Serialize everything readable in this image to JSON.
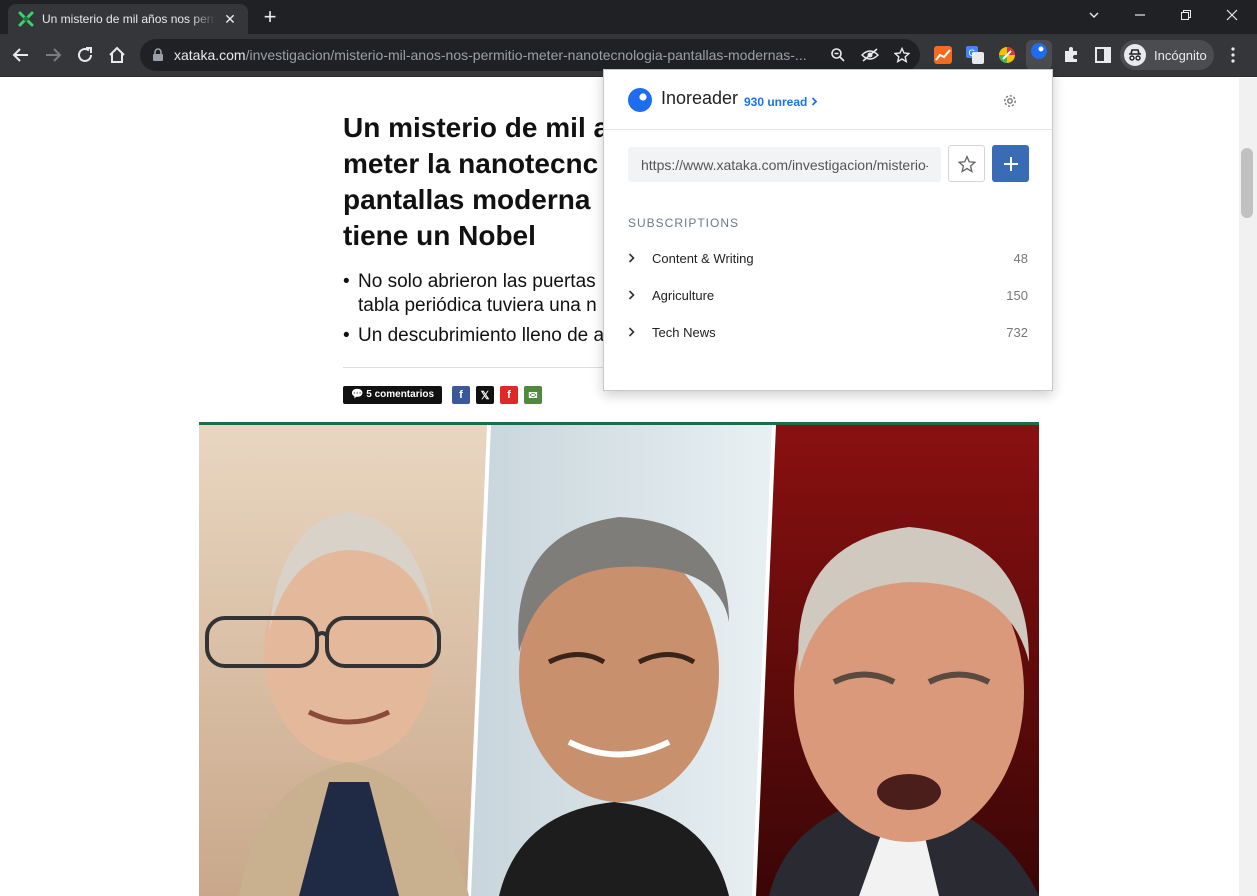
{
  "tab": {
    "title": "Un misterio de mil años nos permitió meter la nanotecnología en las pantallas modernas",
    "close": "✕"
  },
  "new_tab_symbol": "+",
  "omnibox": {
    "host": "xataka.com",
    "path": "/investigacion/misterio-mil-anos-nos-permitio-meter-nanotecnologia-pantallas-modernas-..."
  },
  "extensions": {
    "inoreader_badge": "930"
  },
  "profile": {
    "label": "Incógnito"
  },
  "article": {
    "headline": "Un misterio de mil a meter la nanotecnc pantallas moderna tiene un Nobel",
    "headline_lines": [
      "Un misterio de mil a",
      "meter la nanotecnc",
      "pantallas moderna",
      "tiene un Nobel"
    ],
    "bullets": [
      [
        "No solo abrieron las puertas",
        "tabla periódica tuviera una n"
      ],
      [
        "Un descubrimiento lleno de a"
      ]
    ],
    "comments": "5 comentarios",
    "share": {
      "facebook": "f",
      "x": "𝕏",
      "flipboard": "f",
      "email": "✉"
    }
  },
  "popup": {
    "title": "Inoreader",
    "unread": "930 unread",
    "url_value": "https://www.xataka.com/investigacion/misterio-mil-anos-nos-permitio-meter-nanotecnologia",
    "subscriptions_label": "SUBSCRIPTIONS",
    "subscriptions": [
      {
        "name": "Content & Writing",
        "count": "48"
      },
      {
        "name": "Agriculture",
        "count": "150"
      },
      {
        "name": "Tech News",
        "count": "732"
      }
    ]
  },
  "colors": {
    "accent": "#3a6bb5",
    "link": "#1a73e8",
    "chrome_dark": "#202124",
    "chrome_toolbar": "#35363a"
  }
}
